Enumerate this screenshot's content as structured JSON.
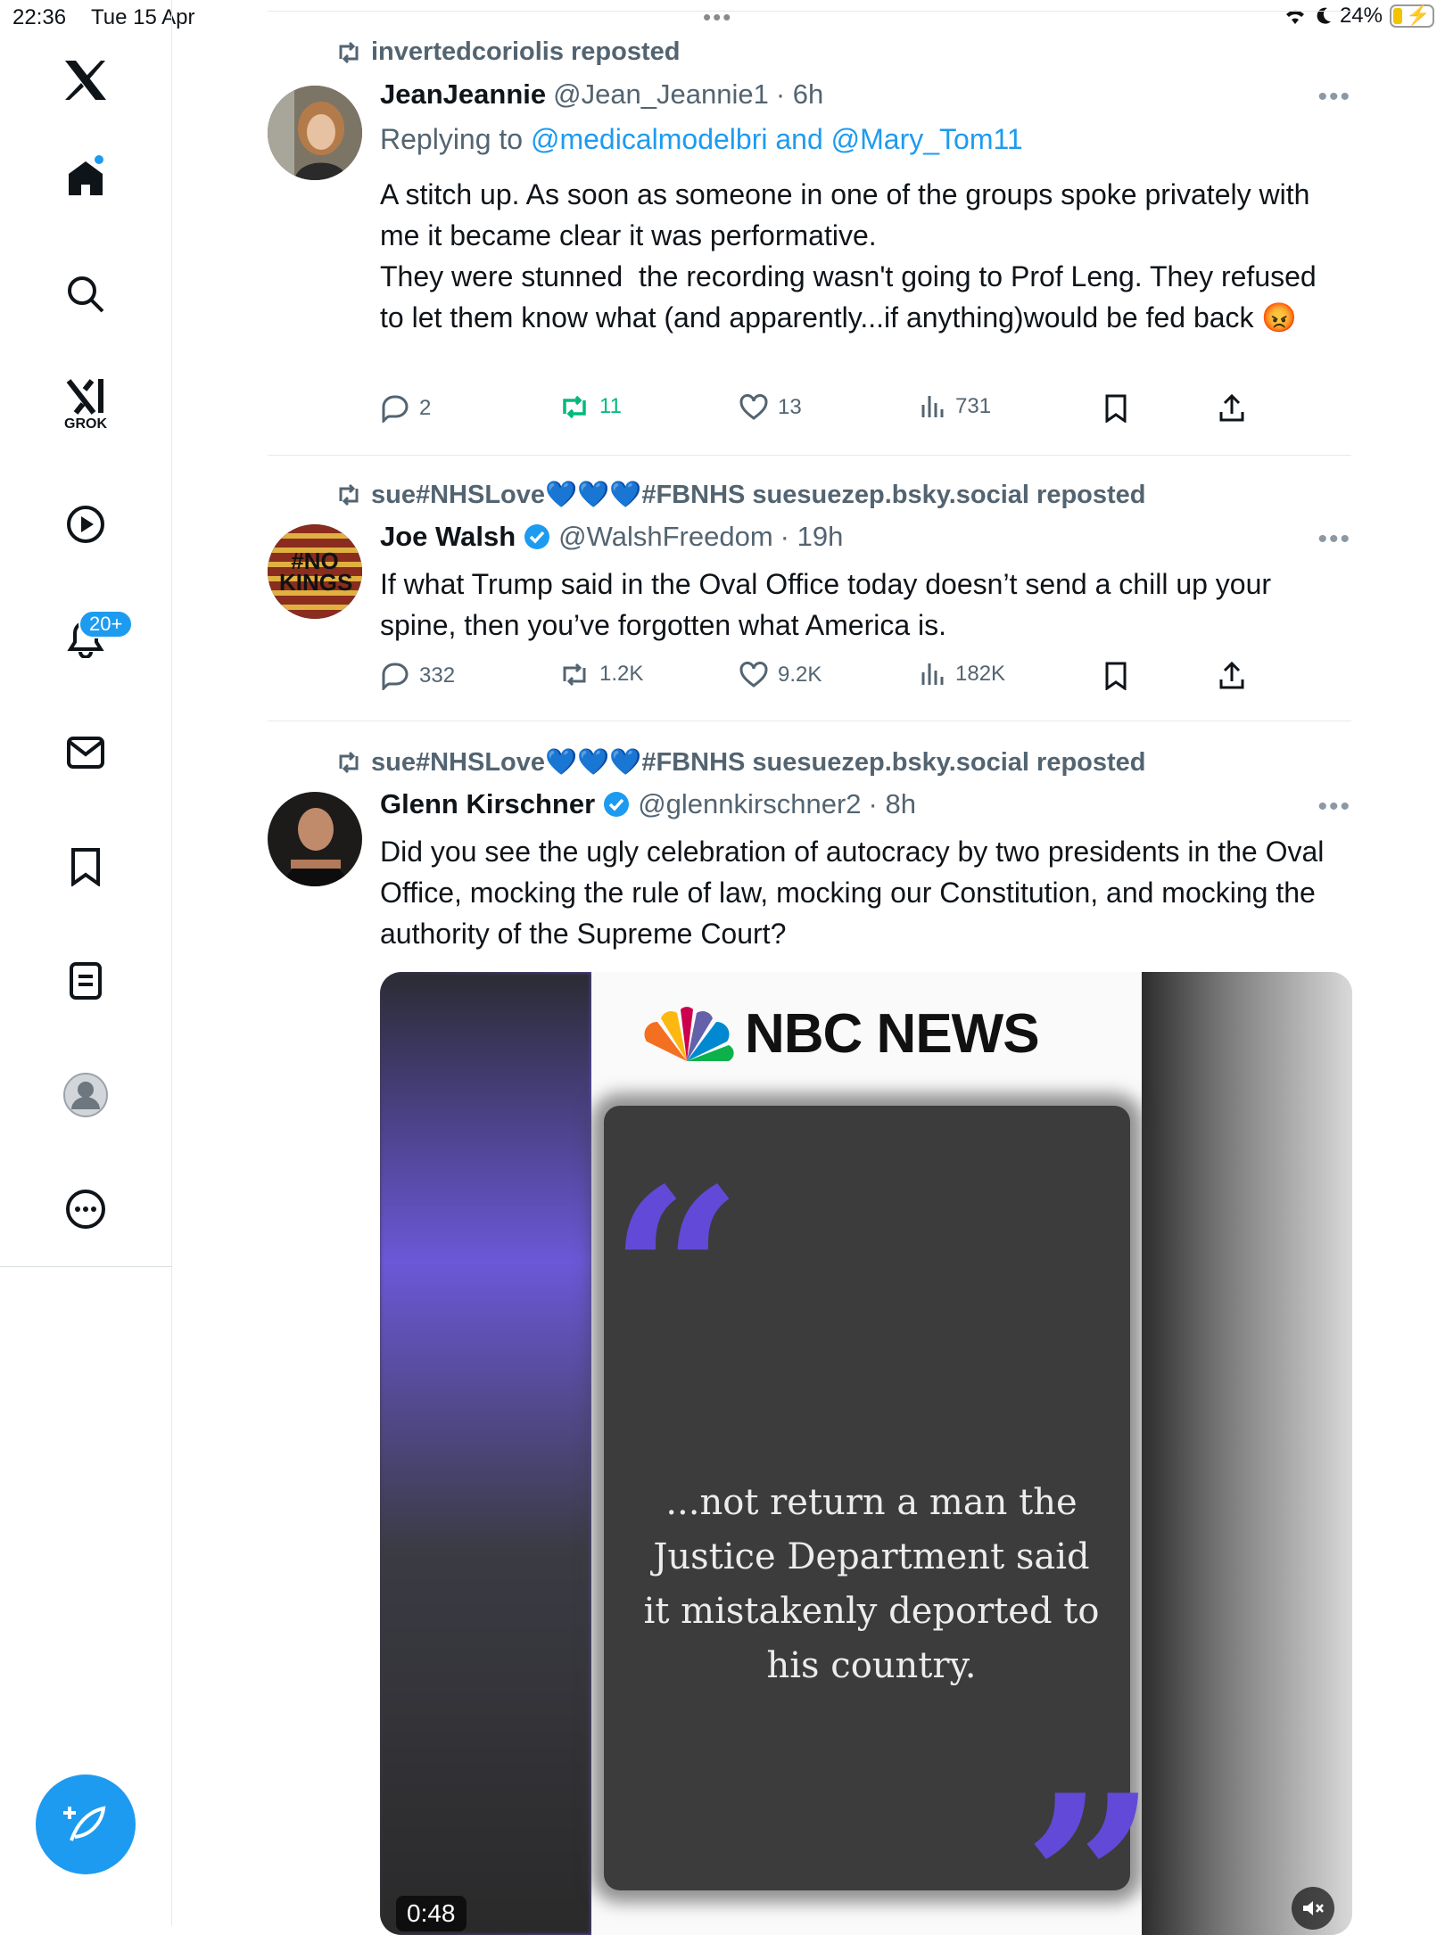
{
  "status_bar": {
    "time": "22:36",
    "date": "Tue 15 Apr",
    "battery": "24%"
  },
  "sidebar": {
    "grok_label": "GROK",
    "notifications_badge": "20+"
  },
  "tweets": [
    {
      "reposted_by": "invertedcoriolis reposted",
      "name": "JeanJeannie",
      "handle": "@Jean_Jeannie1",
      "time": "· 6h",
      "replying_prefix": "Replying to",
      "replying_links": "@medicalmodelbri and @Mary_Tom11",
      "text": "A stitch up. As soon as someone in one of the groups spoke privately with me it became clear it was performative.\nThey were stunned  the recording wasn't going to Prof Leng. They refused to let them know what (and apparently...if anything)would be fed back 😡",
      "replies": "2",
      "reposts": "11",
      "likes": "13",
      "views": "731"
    },
    {
      "reposted_by": "sue#NHSLove💙💙💙#FBNHS suesuezep.bsky.social reposted",
      "name": "Joe Walsh",
      "handle": "@WalshFreedom",
      "time": "· 19h",
      "avatar_text": "#NO KINGS",
      "text": "If what Trump said in the Oval Office today doesn’t send a chill up your spine, then you’ve forgotten what America is.",
      "replies": "332",
      "reposts": "1.2K",
      "likes": "9.2K",
      "views": "182K"
    },
    {
      "reposted_by": "sue#NHSLove💙💙💙#FBNHS suesuezep.bsky.social reposted",
      "name": "Glenn Kirschner",
      "handle": "@glennkirschner2",
      "time": "· 8h",
      "text": "Did you see the ugly celebration of autocracy by two presidents in the Oval Office, mocking the rule of law, mocking our Constitution, and mocking the authority of the Supreme Court?",
      "media": {
        "brand": "NBC NEWS",
        "quote": "...not return a man the Justice Department said it mistakenly deported to his country.",
        "duration": "0:48"
      }
    }
  ]
}
